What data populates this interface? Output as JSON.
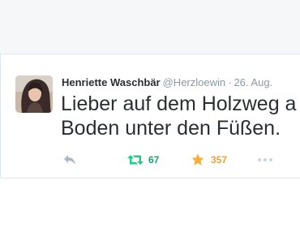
{
  "tweet": {
    "display_name": "Henriette Waschbär",
    "handle": "@Herzloewin",
    "separator": "·",
    "date": "26. Aug.",
    "text_line1": "Lieber auf dem Holzweg a",
    "text_line2": "Boden unter den Füßen.",
    "avatar_icon": "profile-photo"
  },
  "actions": {
    "reply_icon": "reply-icon",
    "retweet_icon": "retweet-icon",
    "retweet_count": "67",
    "favorite_icon": "star-icon",
    "favorite_count": "357",
    "more_icon": "more-icon"
  },
  "colors": {
    "retweet_green": "#19cf86",
    "favorite_gold": "#ffac33",
    "text": "#292f33",
    "muted": "#8899a6",
    "border": "#e1e8ed",
    "page_bg": "#f6f7f9"
  }
}
